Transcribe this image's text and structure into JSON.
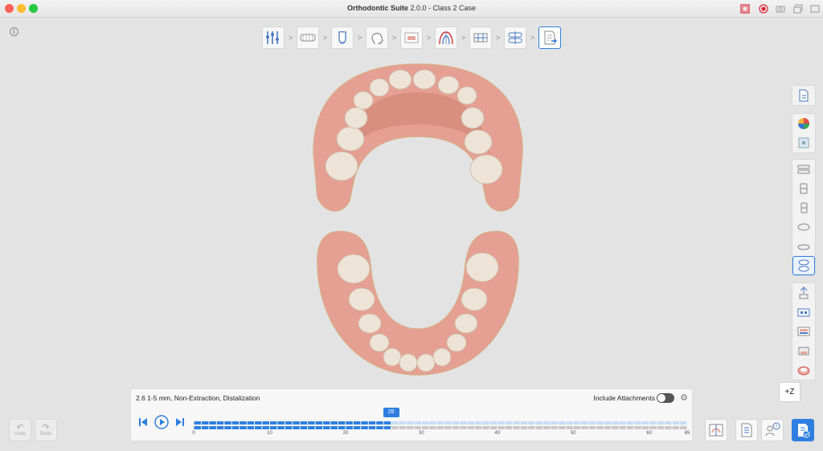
{
  "window": {
    "title_bold": "Orthodontic Suite",
    "title_rest": " 2.0.0 - Class 2 Case",
    "title_icons": [
      "fullscreen-icon",
      "record-icon",
      "camera-icon",
      "window-icon"
    ]
  },
  "workflow": {
    "steps": [
      "segmentation-step",
      "arch-step",
      "tooth-step",
      "face-step",
      "aligner-step",
      "arch-form-step",
      "ipr-step",
      "staging-step",
      "report-step"
    ],
    "arrow": ">"
  },
  "info_glyph": "i",
  "sidebar": {
    "icons": [
      "document-icon",
      "color-map-icon",
      "image-icon",
      "jaw-front-icon",
      "jaw-left-icon",
      "jaw-right-icon",
      "jaw-top-icon",
      "jaw-bottom-icon",
      "jaw-split-icon",
      "tooth-move-icon",
      "attachment-icon",
      "ipr-icon",
      "gingiva-icon",
      "bite-icon"
    ]
  },
  "z_button": "+Z",
  "timeline": {
    "plan_text": "2.6 1-5 mm, Non-Extraction, Distalization",
    "attachments_label": "Include Attachments",
    "attachments_on": false,
    "current_stage": "26",
    "current_stage_value": 26,
    "total_stages": 65,
    "ticks": [
      "0",
      "10",
      "20",
      "30",
      "40",
      "50",
      "60",
      "65"
    ]
  },
  "undo_label": "Undo",
  "redo_label": "Redo",
  "bottom_right_icons": [
    "comparison-icon",
    "report-icon",
    "consult-icon",
    "export-icon"
  ],
  "colors": {
    "accent": "#2f7fe0",
    "gum": "#e8a59a",
    "tooth": "#ede3d6"
  }
}
